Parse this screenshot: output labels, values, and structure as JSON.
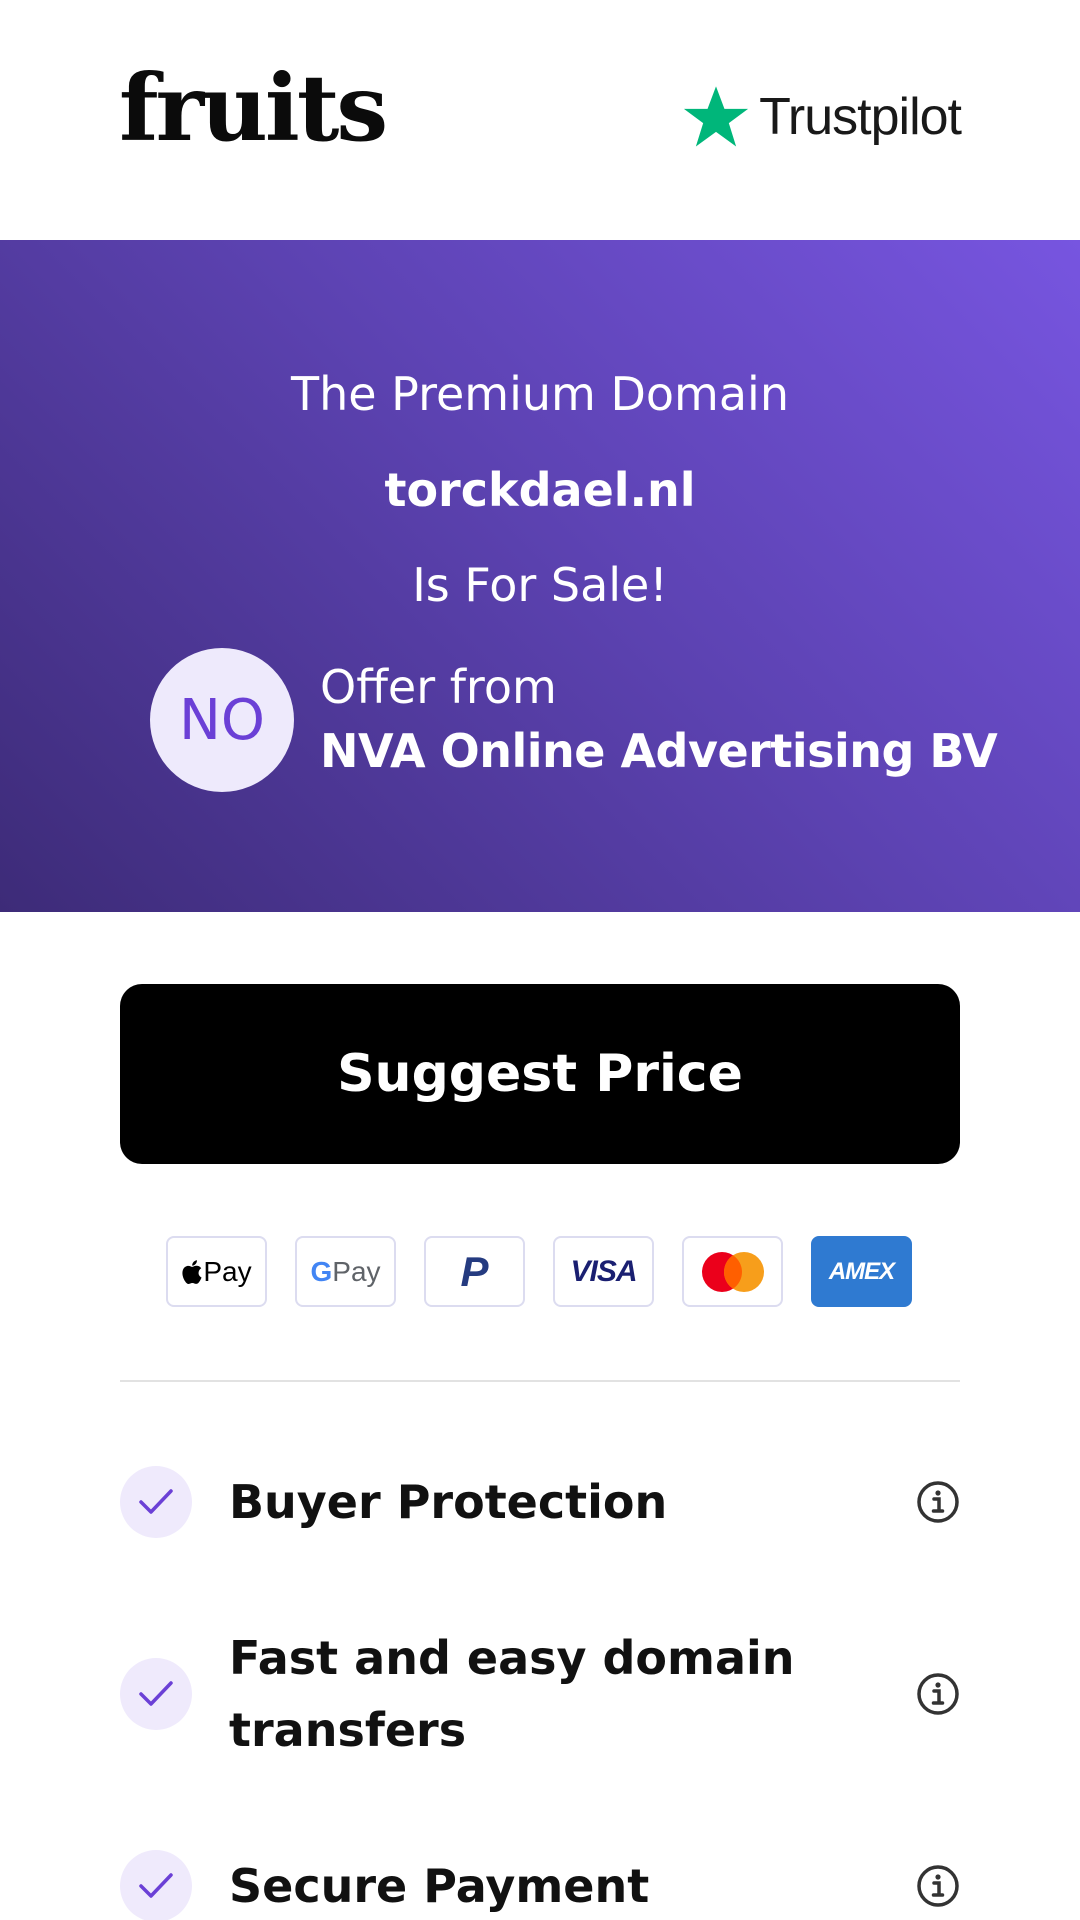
{
  "header": {
    "logo_text": "fruits",
    "trustpilot_label": "Trustpilot",
    "trustpilot_star_color": "#00b67a"
  },
  "hero": {
    "line1": "The Premium Domain",
    "domain": "torckdael.nl",
    "line3": "Is For Sale!",
    "seller": {
      "avatar_initials": "NO",
      "offer_label": "Offer from",
      "name": "NVA Online Advertising BV"
    },
    "gradient_colors": [
      "#7755e0",
      "#3d2b78"
    ]
  },
  "cta": {
    "label": "Suggest Price"
  },
  "payments": {
    "apple_pay": "Pay",
    "google_pay_g": "G",
    "google_pay": "Pay",
    "paypal": "P",
    "visa": "VISA",
    "amex": "AMEX"
  },
  "features": [
    {
      "label": "Buyer Protection",
      "icon": "check-icon",
      "info_icon": "info-icon"
    },
    {
      "label": "Fast and easy domain transfers",
      "icon": "check-icon",
      "info_icon": "info-icon"
    },
    {
      "label": "Secure Payment",
      "icon": "check-icon",
      "info_icon": "info-icon"
    }
  ],
  "colors": {
    "accent": "#6b40d6",
    "check_bg": "#efeafc"
  }
}
